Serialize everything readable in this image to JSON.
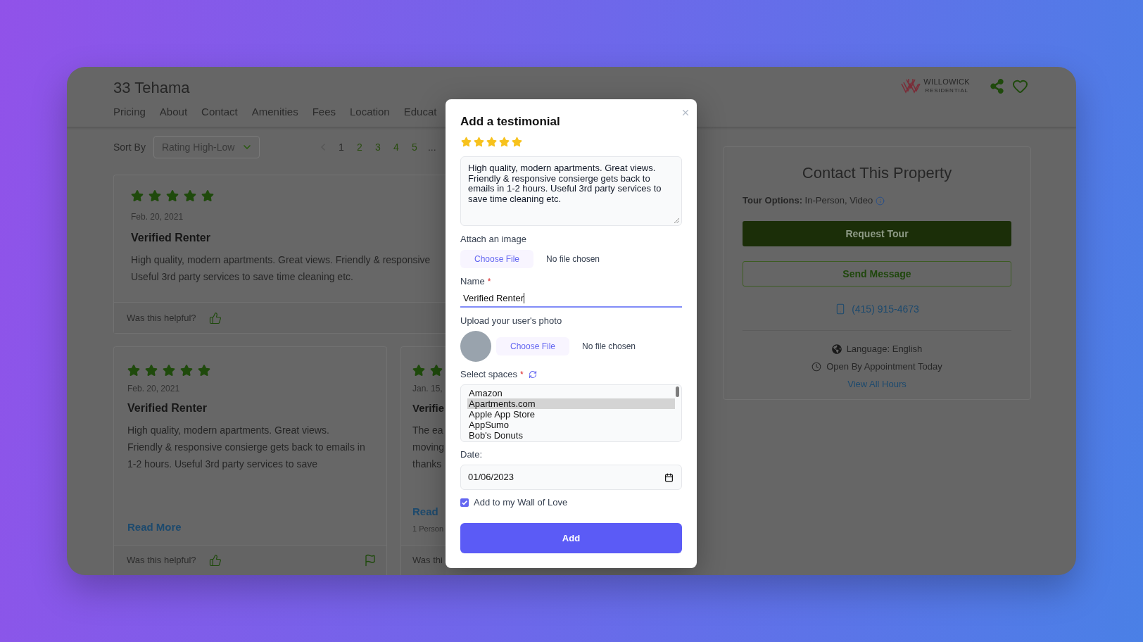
{
  "header": {
    "title": "33 Tehama",
    "nav": [
      {
        "label": "Pricing"
      },
      {
        "label": "About"
      },
      {
        "label": "Contact"
      },
      {
        "label": "Amenities"
      },
      {
        "label": "Fees"
      },
      {
        "label": "Location"
      },
      {
        "label": "Educat"
      }
    ],
    "logo": {
      "name": "WILLOWICK",
      "subtitle": "RESIDENTIAL"
    }
  },
  "sort": {
    "label": "Sort By",
    "value": "Rating High-Low"
  },
  "pagination": {
    "pages": [
      {
        "label": "1",
        "selected": true
      },
      {
        "label": "2",
        "selected": false
      },
      {
        "label": "3",
        "selected": false
      },
      {
        "label": "4",
        "selected": false
      },
      {
        "label": "5",
        "selected": false
      }
    ],
    "more": "..."
  },
  "reviews": [
    {
      "kind": "wide",
      "stars": 5,
      "date": "Feb. 20, 2021",
      "author": "Verified Renter",
      "body_lines": [
        "High quality, modern apartments. Great views. Friendly & responsive",
        "Useful 3rd party services to save time cleaning etc."
      ],
      "helpful_prompt": "Was this helpful?"
    },
    {
      "kind": "tile",
      "stars": 5,
      "date": "Feb. 20, 2021",
      "author": "Verified Renter",
      "body_lines": [
        "High quality, modern apartments. Great views.",
        "Friendly & responsive consierge gets back to emails in",
        "1-2 hours. Useful 3rd party services to save"
      ],
      "read_more": "Read More",
      "helpful_prompt": "Was this helpful?"
    },
    {
      "kind": "clipped",
      "date": "Jan. 15,",
      "author": "Verifie",
      "body_lines": [
        "The ea",
        "moving",
        "thanks"
      ],
      "read_more": "Read",
      "helpful_count": "1 Person",
      "helpful_prompt": "Was thi"
    }
  ],
  "contact": {
    "title": "Contact This Property",
    "tour_options": "**Tour Options:** In-Person, Video",
    "actions": [
      {
        "label": "Request Tour",
        "kind": "primary"
      },
      {
        "label": "Send Message",
        "kind": "outline"
      }
    ],
    "phone": "(415) 915-4673",
    "details": [
      {
        "kind": "language",
        "text": "Language: English"
      },
      {
        "kind": "hours",
        "text": "Open By Appointment Today"
      }
    ],
    "hours_link": "View All Hours"
  },
  "modal": {
    "title": "Add a testimonial",
    "stars": 5,
    "review_text": "High quality, modern apartments. Great views. Friendly & responsive consierge gets back to emails in 1-2 hours. Useful 3rd party services to save time cleaning etc.",
    "image_field": {
      "label": "Attach an image",
      "button": "Choose File",
      "status": "No file chosen"
    },
    "name_field": {
      "label": "Name",
      "required_mark": "*",
      "value": "Verified Renter"
    },
    "photo_field": {
      "label": "Upload your user's photo",
      "button": "Choose File",
      "status": "No file chosen"
    },
    "spaces_field": {
      "label": "Select spaces",
      "required_mark": "*",
      "options": [
        {
          "label": "Amazon",
          "selected": false
        },
        {
          "label": "Apartments.com",
          "selected": true
        },
        {
          "label": "Apple App Store",
          "selected": false
        },
        {
          "label": "AppSumo",
          "selected": false
        },
        {
          "label": "Bob's Donuts",
          "selected": false
        }
      ]
    },
    "date_field": {
      "label": "Date:",
      "value": "01/06/2023"
    },
    "wall_of_love": {
      "label": "Add to my Wall of Love",
      "checked": true
    },
    "submit": "Add"
  }
}
